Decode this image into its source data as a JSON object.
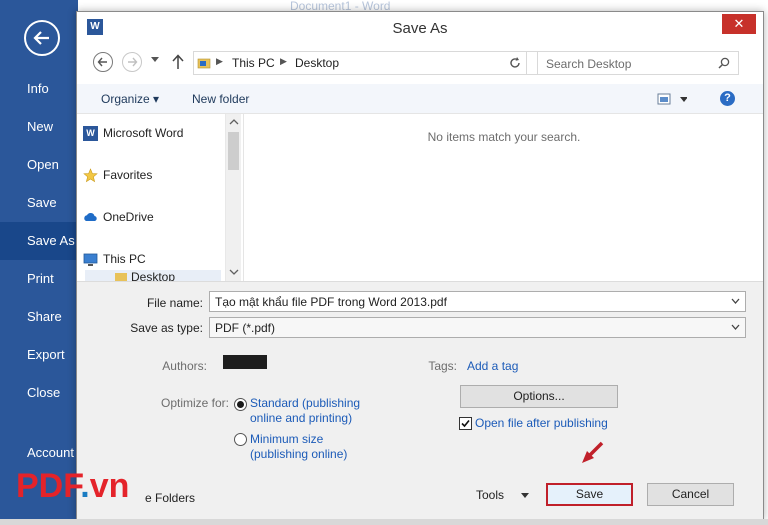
{
  "backstage": {
    "doc_title": "Document1 - Word",
    "items": [
      {
        "label": "Info"
      },
      {
        "label": "New"
      },
      {
        "label": "Open"
      },
      {
        "label": "Save"
      },
      {
        "label": "Save As",
        "active": true
      },
      {
        "label": "Print"
      },
      {
        "label": "Share"
      },
      {
        "label": "Export"
      },
      {
        "label": "Close"
      },
      {
        "label": "Account"
      }
    ]
  },
  "dialog": {
    "title": "Save As",
    "close_glyph": "✕",
    "address": {
      "segments": [
        "This PC",
        "Desktop"
      ]
    },
    "search": {
      "placeholder": "Search Desktop"
    },
    "toolbar": {
      "organize": "Organize ▾",
      "new_folder": "New folder",
      "help": "?"
    },
    "nav": {
      "items": [
        "Microsoft Word",
        "Favorites",
        "OneDrive",
        "This PC",
        "Desktop"
      ]
    },
    "content": {
      "empty_message": "No items match your search."
    },
    "form": {
      "file_name_label": "File name:",
      "file_name_value": "Tạo mật khẩu file PDF trong Word 2013.pdf",
      "save_as_type_label": "Save as type:",
      "save_as_type_value": "PDF (*.pdf)",
      "authors_label": "Authors:",
      "tags_label": "Tags:",
      "add_tag": "Add a tag",
      "optimize_label": "Optimize for:",
      "opt_standard_1": "Standard (publishing",
      "opt_standard_2": "online and printing)",
      "opt_minimum_1": "Minimum size",
      "opt_minimum_2": "(publishing online)",
      "options_button": "Options...",
      "open_after": "Open file after publishing",
      "hide_folders": "e Folders",
      "tools": "Tools",
      "save_button": "Save",
      "cancel_button": "Cancel"
    }
  },
  "watermark": {
    "pdf": "PDF",
    "dot": ".",
    "vn": "vn"
  },
  "colors": {
    "word_blue": "#2b579a",
    "close_red": "#c7312a",
    "highlight_red": "#c0202a",
    "link_blue": "#1c5bb8"
  }
}
